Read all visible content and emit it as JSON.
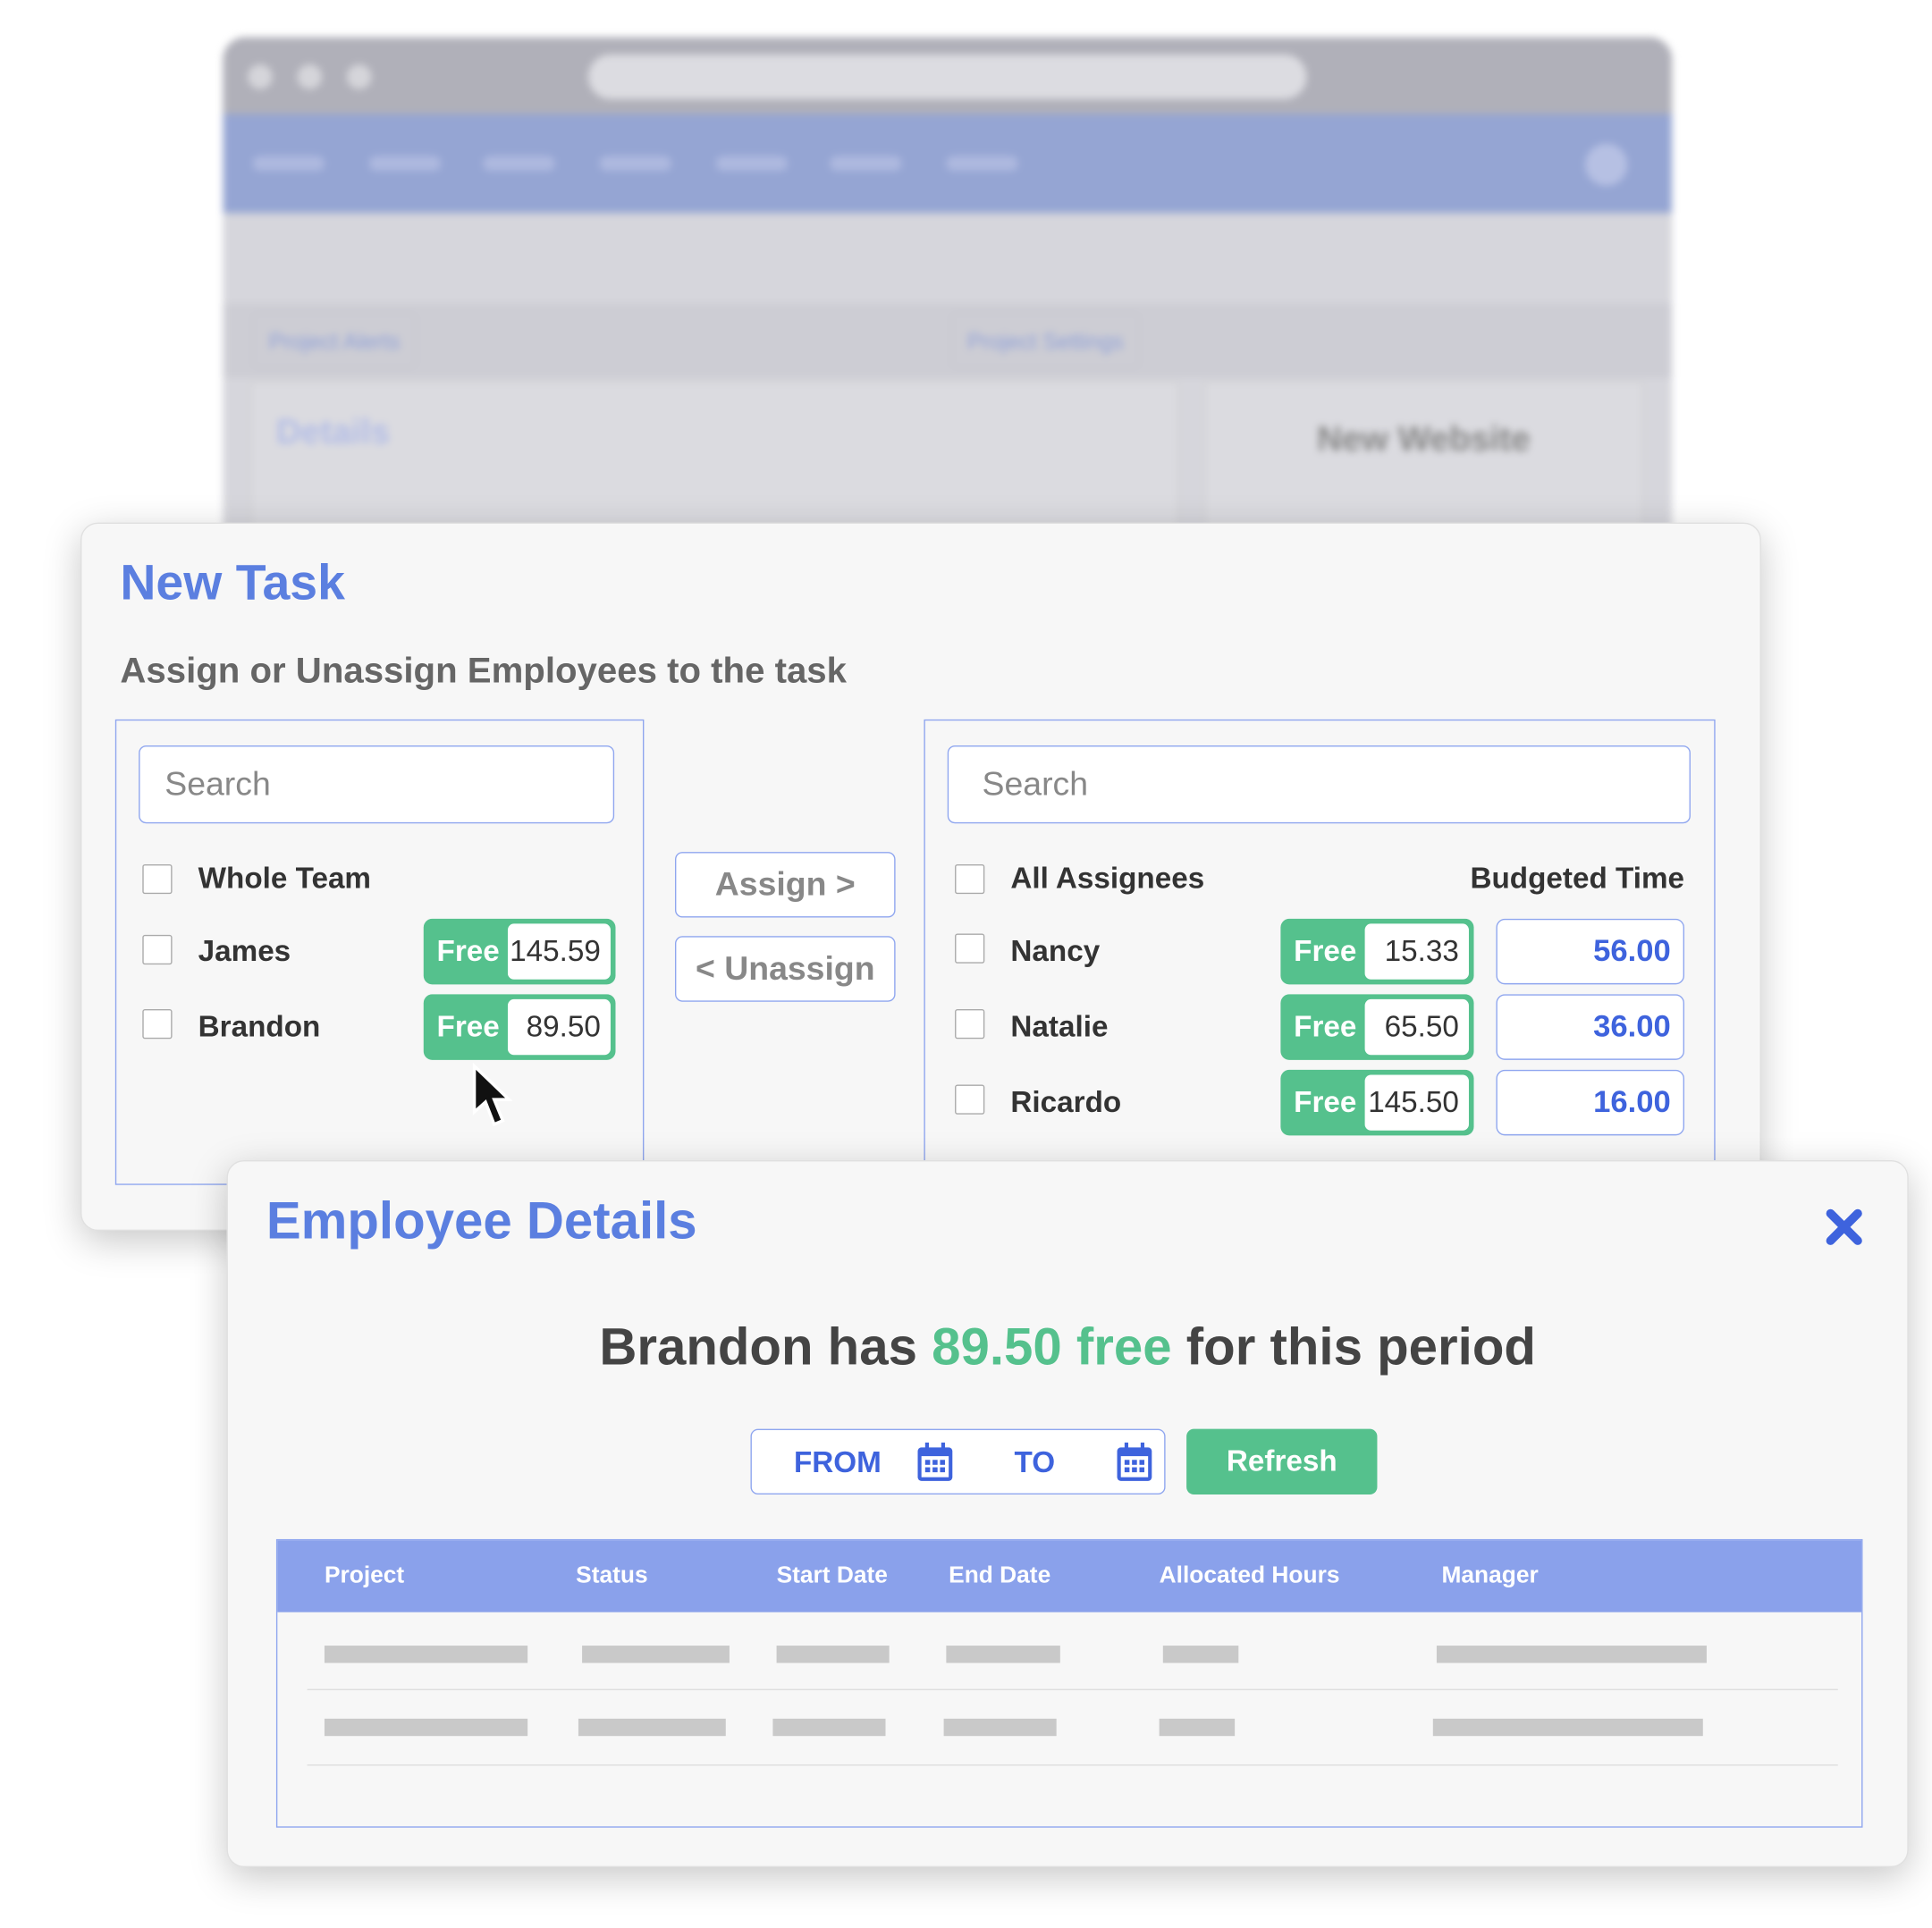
{
  "background_app": {
    "tabs": [
      "Project Alerts",
      "Project Settings"
    ],
    "details_title": "Details",
    "project_name": "New Website"
  },
  "new_task": {
    "title": "New Task",
    "subtitle": "Assign or Unassign Employees to the task",
    "left_panel": {
      "search_placeholder": "Search",
      "select_all_label": "Whole Team",
      "employees": [
        {
          "name": "James",
          "free_label": "Free",
          "free_value": "145.59"
        },
        {
          "name": "Brandon",
          "free_label": "Free",
          "free_value": "89.50"
        }
      ]
    },
    "assign_label": "Assign >",
    "unassign_label": "< Unassign",
    "right_panel": {
      "search_placeholder": "Search",
      "select_all_label": "All Assignees",
      "budget_header": "Budgeted Time",
      "assignees": [
        {
          "name": "Nancy",
          "free_label": "Free",
          "free_value": "15.33",
          "budget": "56.00"
        },
        {
          "name": "Natalie",
          "free_label": "Free",
          "free_value": "65.50",
          "budget": "36.00"
        },
        {
          "name": "Ricardo",
          "free_label": "Free",
          "free_value": "145.50",
          "budget": "16.00"
        }
      ]
    }
  },
  "employee_details": {
    "title": "Employee Details",
    "headline_pre": "Brandon has ",
    "headline_highlight": "89.50 free",
    "headline_post": " for this period",
    "from_label": "FROM",
    "to_label": "TO",
    "refresh_label": "Refresh",
    "table": {
      "columns": [
        "Project",
        "Status",
        "Start Date",
        "End Date",
        "Allocated Hours",
        "Manager"
      ]
    }
  },
  "colors": {
    "accent_blue": "#5b7fe0",
    "value_blue": "#3e63dd",
    "free_green": "#55c18d",
    "table_header": "#8aa1eb"
  }
}
